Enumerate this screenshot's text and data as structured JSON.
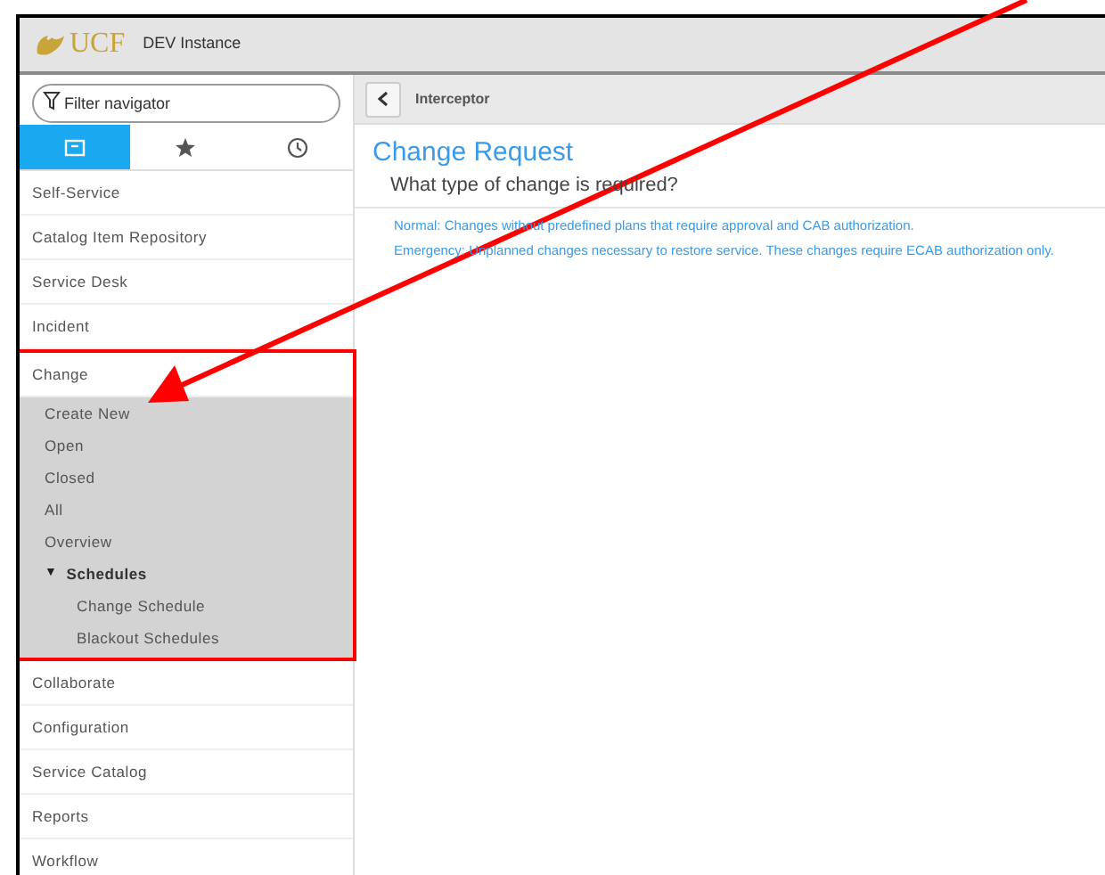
{
  "header": {
    "logo": "UCF",
    "instance": "DEV Instance"
  },
  "filter": {
    "placeholder": "Filter navigator"
  },
  "nav_tabs": [
    {
      "kind": "all",
      "selected": true
    },
    {
      "kind": "favorites",
      "selected": false
    },
    {
      "kind": "history",
      "selected": false
    }
  ],
  "nav": [
    {
      "label": "Self-Service"
    },
    {
      "label": "Catalog Item Repository"
    },
    {
      "label": "Service Desk"
    },
    {
      "label": "Incident"
    },
    {
      "label": "Change",
      "expanded": true,
      "children": [
        {
          "label": "Create New"
        },
        {
          "label": "Open"
        },
        {
          "label": "Closed"
        },
        {
          "label": "All"
        },
        {
          "label": "Overview"
        },
        {
          "label": "Schedules",
          "toggle": "▼",
          "expanded": true,
          "children": [
            {
              "label": "Change Schedule"
            },
            {
              "label": "Blackout Schedules"
            }
          ]
        }
      ]
    },
    {
      "label": "Collaborate"
    },
    {
      "label": "Configuration"
    },
    {
      "label": "Service Catalog"
    },
    {
      "label": "Reports"
    },
    {
      "label": "Workflow"
    }
  ],
  "breadcrumb": "Interceptor",
  "title": "Change Request",
  "question": "What type of change is required?",
  "options": [
    "Normal: Changes without predefined plans that require approval and CAB authorization.",
    "Emergency: Unplanned changes necessary to restore service. These changes require ECAB authorization only."
  ]
}
